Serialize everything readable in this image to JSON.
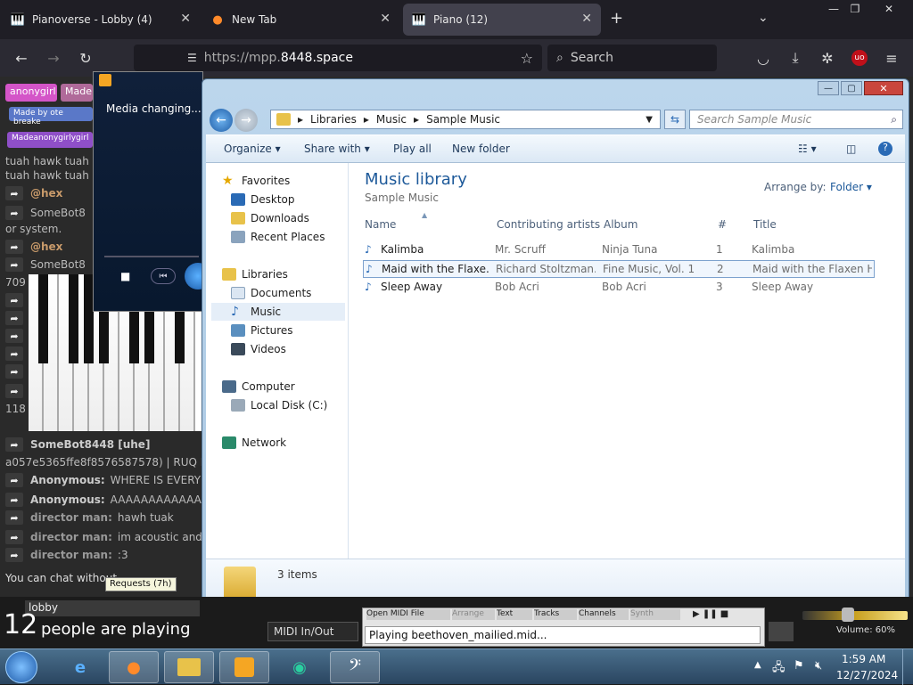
{
  "browser": {
    "tabs": [
      {
        "label": "Pianoverse - Lobby (4)",
        "icon": "piano-icon"
      },
      {
        "label": "New Tab",
        "icon": "firefox-icon"
      },
      {
        "label": "Piano (12)",
        "icon": "piano-icon"
      }
    ],
    "url_prefix": "https://mpp.",
    "url_domain": "8448.space",
    "search_placeholder": "Search",
    "ext_badge": "uo"
  },
  "page": {
    "tags": [
      {
        "label": "anonygirl",
        "color": "#d455c8"
      },
      {
        "label": "Made",
        "color": "#b06a9a"
      },
      {
        "label": "Made by ote breake",
        "color": "#5a78c8"
      },
      {
        "label": "Madeanonygirlygirl",
        "color": "#8f4fc8"
      }
    ],
    "chat": [
      {
        "name": "",
        "text": "tuah hawk tuah"
      },
      {
        "name": "",
        "text": "tuah hawk tuah"
      },
      {
        "name": "@hex",
        "text": ""
      },
      {
        "name": "",
        "text": "SomeBot8"
      },
      {
        "name": "",
        "text": "or system."
      },
      {
        "name": "@hex",
        "text": ""
      },
      {
        "name": "",
        "text": "SomeBot8"
      },
      {
        "name": "",
        "text": "709"
      },
      {
        "name": "",
        "text": "118"
      },
      {
        "name": "SomeBot8448 [uhe]",
        "text": ""
      },
      {
        "name": "",
        "text": "a057e5365ffe8f8576587578) | RUQ ID"
      },
      {
        "name": "Anonymous:",
        "text": "WHERE IS EVERY"
      },
      {
        "name": "Anonymous:",
        "text": "AAAAAAAAAAAAAA"
      },
      {
        "name": "director man:",
        "text": "hawh tuak"
      },
      {
        "name": "director man:",
        "text": "im acoustic and"
      },
      {
        "name": "director man:",
        "text": ":3"
      }
    ],
    "chat_hint": "You can chat without",
    "requests_tooltip": "Requests (7h)",
    "room_name": "lobby",
    "people_count": "12",
    "people_label": "people are playing",
    "midi_button": "MIDI In/Out",
    "midi_tabs": [
      "Open MIDI File",
      "Arrange",
      "Text",
      "Tracks",
      "Channels",
      "Synth"
    ],
    "now_playing": "Playing beethoven_mailied.mid...",
    "volume_label": "Volume: 60%",
    "volume": 60
  },
  "media_player": {
    "status": "Media changing..."
  },
  "explorer": {
    "breadcrumb": [
      "Libraries",
      "Music",
      "Sample Music"
    ],
    "search_placeholder": "Search Sample Music",
    "toolbar": {
      "organize": "Organize",
      "share_with": "Share with",
      "play_all": "Play all",
      "new_folder": "New folder"
    },
    "nav": {
      "favorites": "Favorites",
      "desktop": "Desktop",
      "downloads": "Downloads",
      "recent": "Recent Places",
      "libraries": "Libraries",
      "documents": "Documents",
      "music": "Music",
      "pictures": "Pictures",
      "videos": "Videos",
      "computer": "Computer",
      "local_disk": "Local Disk (C:)",
      "network": "Network"
    },
    "library_title": "Music library",
    "library_sub": "Sample Music",
    "arrange_label": "Arrange by:",
    "arrange_value": "Folder",
    "columns": [
      "Name",
      "Contributing artists",
      "Album",
      "#",
      "Title"
    ],
    "files": [
      {
        "name": "Kalimba",
        "artist": "Mr. Scruff",
        "album": "Ninja Tuna",
        "num": "1",
        "title": "Kalimba"
      },
      {
        "name": "Maid with the Flaxe...",
        "artist": "Richard Stoltzman...",
        "album": "Fine Music, Vol. 1",
        "num": "2",
        "title": "Maid with the Flaxen H..."
      },
      {
        "name": "Sleep Away",
        "artist": "Bob Acri",
        "album": "Bob Acri",
        "num": "3",
        "title": "Sleep Away"
      }
    ],
    "item_count": "3 items"
  },
  "taskbar": {
    "time": "1:59 AM",
    "date": "12/27/2024"
  }
}
